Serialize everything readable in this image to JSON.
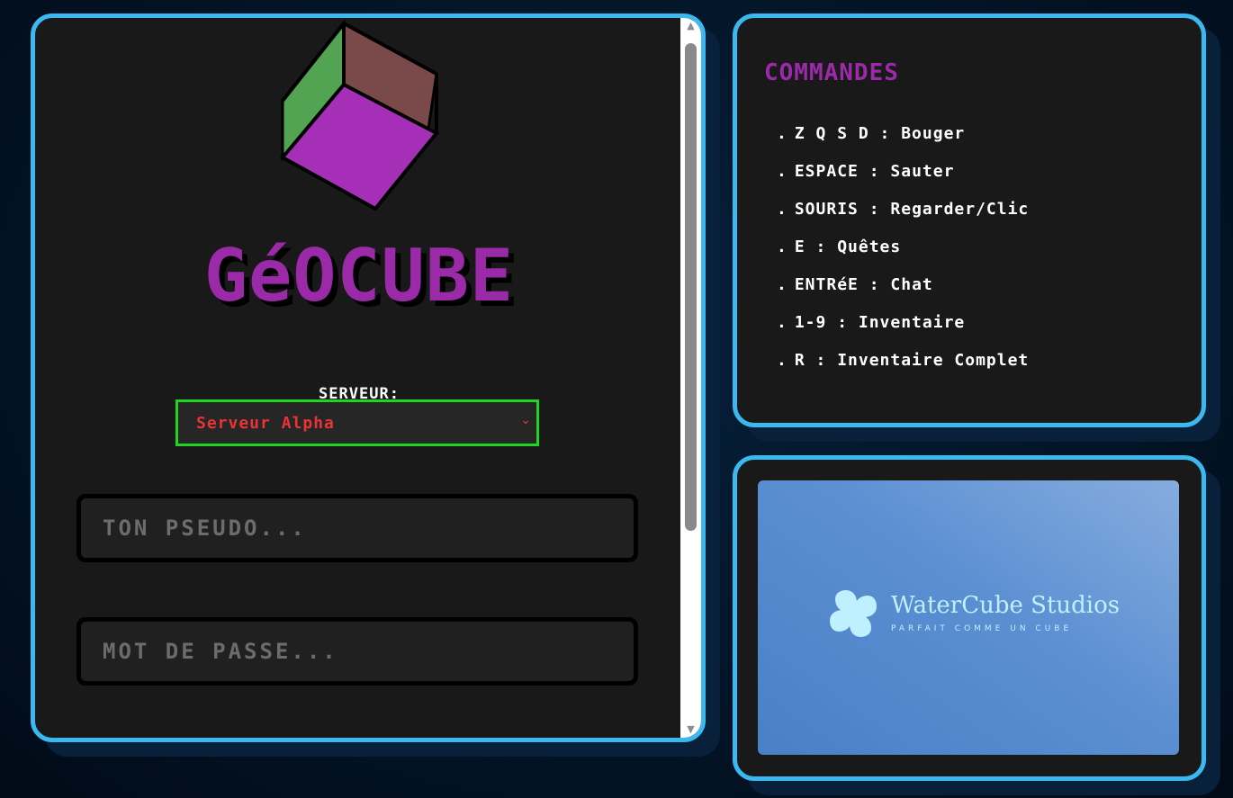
{
  "login": {
    "title": "GéOCUBE",
    "server_label": "SERVEUR:",
    "server_selected": "Serveur Alpha",
    "pseudo_placeholder": "TON PSEUDO...",
    "password_placeholder": "MOT DE PASSE..."
  },
  "commands": {
    "title": "COMMANDES",
    "items": [
      {
        "keys": "Z Q S D",
        "action": "Bouger"
      },
      {
        "keys": "ESPACE",
        "action": "Sauter"
      },
      {
        "keys": "SOURIS",
        "action": "Regarder/Clic"
      },
      {
        "keys": "E",
        "action": "Quêtes"
      },
      {
        "keys": "ENTRéE",
        "action": "Chat"
      },
      {
        "keys": "1-9",
        "action": "Inventaire"
      },
      {
        "keys": "R",
        "action": "Inventaire Complet"
      }
    ]
  },
  "studio": {
    "name": "WaterCube Studios",
    "tagline": "PARFAIT COMME UN CUBE"
  },
  "colors": {
    "panel_border": "#3bb8f0",
    "title_purple": "#9b2aa8",
    "select_border": "#1fd51f",
    "select_text": "#e83434"
  },
  "icons": [
    "cube-logo-icon",
    "chevron-down-icon",
    "watercube-logo-icon",
    "scroll-up-arrow-icon",
    "scroll-down-arrow-icon"
  ]
}
